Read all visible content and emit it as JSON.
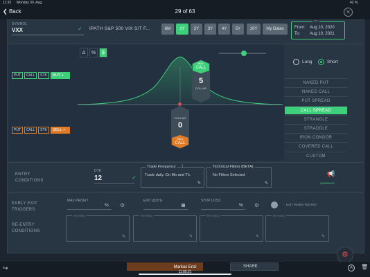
{
  "status": {
    "time": "11:33",
    "date": "Monday 30. Aug.",
    "battery": "42 %"
  },
  "nav": {
    "back": "Back",
    "counter": "29 of 63"
  },
  "symbol": {
    "label": "SYMBOL",
    "value": "VXX",
    "name": "IPATH S&P 500 VIX S/T F..."
  },
  "periods": [
    "6M",
    "1Y",
    "2Y",
    "3Y",
    "4Y",
    "5Y",
    "10Y",
    "My Dates"
  ],
  "active_period": "1Y",
  "dates": {
    "title": "7Y",
    "from_label": "From:",
    "from": "Aug 10, 2020",
    "to_label": "To:",
    "to": "Aug 10, 2021"
  },
  "modes": [
    "Δ",
    "%",
    "$"
  ],
  "legs": {
    "buy": {
      "items": [
        "PUT",
        "CALL",
        "STK"
      ],
      "action": "BUY"
    },
    "sell": {
      "items": [
        "PUT",
        "CALL",
        "STK"
      ],
      "action": "SELL"
    }
  },
  "markers": {
    "buy": {
      "tag": "BUY",
      "type": "CALL",
      "value": "5",
      "unit": "DOLLAR"
    },
    "sell": {
      "tag": "SELL",
      "type": "CALL",
      "value": "0",
      "unit": "DOLLAR"
    }
  },
  "direction": {
    "long": "Long",
    "short": "Short",
    "selected": "Short"
  },
  "strategies": [
    "NAKED PUT",
    "NAKED CALL",
    "PUT SPREAD",
    "CALL SPREAD",
    "STRANGLE",
    "STRADDLE",
    "IRON CONDOR",
    "COVERED CALL",
    "CUSTOM"
  ],
  "active_strategy": "CALL SPREAD",
  "entry": {
    "label": "ENTRY CONDITIONS",
    "dte_label": "DTE",
    "dte_value": "12",
    "trade_freq_title": "Trade Frequency",
    "trade_freq_value": "Trade daily. On Mo and Th.",
    "tech_title": "Technical Filters (BETA)",
    "tech_value": "No Filters Selected",
    "earnings": "EARNINGS"
  },
  "exit": {
    "label": "EARLY EXIT TRIGGERS",
    "max_profit": "MAX PROFIT",
    "exit_dte": "EXIT @DTE",
    "stop_loss": "STOP LOSS",
    "when_tested": "EXIT WHEN TESTED",
    "pct": "%"
  },
  "reentry": {
    "label": "RE-ENTRY CONDITIONS",
    "placeholder": "Re-entry"
  },
  "bottom": {
    "user": "Markus Enzi",
    "clock": "11:05:21",
    "share": "SHARE"
  },
  "colors": {
    "accent": "#3ecf7a",
    "sell": "#e07b28",
    "panel": "#283643"
  }
}
